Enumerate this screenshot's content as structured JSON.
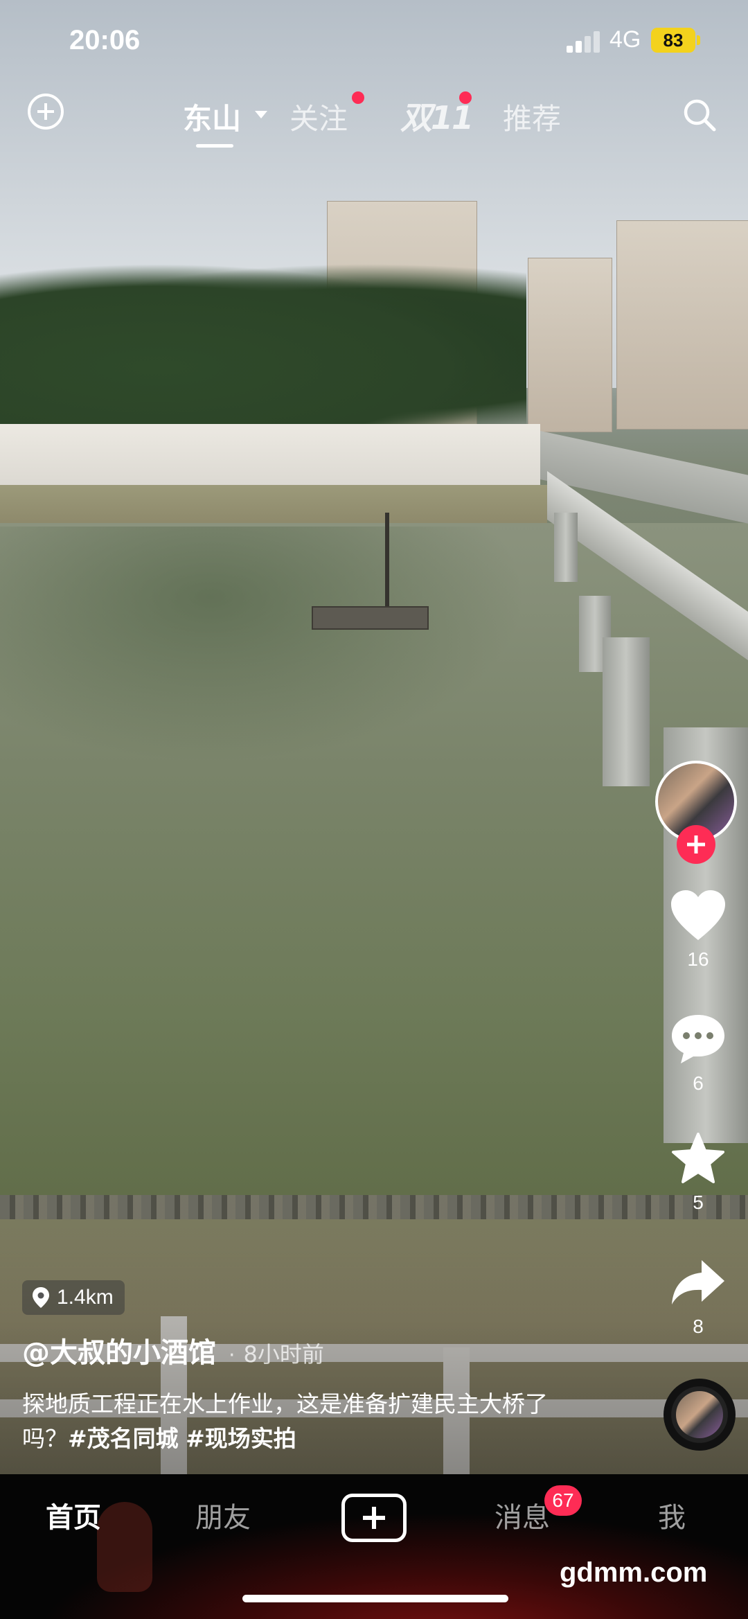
{
  "status_bar": {
    "time": "20:06",
    "network": "4G",
    "battery": "83"
  },
  "top_nav": {
    "tabs": [
      {
        "label": "东山",
        "active": true
      },
      {
        "label": "关注",
        "dot": true
      },
      {
        "label": "双11",
        "dot": true
      },
      {
        "label": "推荐"
      }
    ]
  },
  "actions": {
    "likes": "16",
    "comments": "6",
    "favorites": "5",
    "shares": "8"
  },
  "post": {
    "location": "1.4km",
    "author": "@大叔的小酒馆",
    "separator": "·",
    "time_ago": "8小时前",
    "caption_text": "探地质工程正在水上作业，这是准备扩建民主大桥了吗？",
    "tags": [
      "#茂名同城",
      "#现场实拍"
    ]
  },
  "bottom_nav": {
    "items": [
      "首页",
      "朋友",
      "消息",
      "我"
    ],
    "message_badge": "67"
  },
  "watermark": "gdmm.com",
  "colors": {
    "accent": "#fe2c55",
    "battery": "#f3d21d",
    "tabbar": "#050505"
  }
}
